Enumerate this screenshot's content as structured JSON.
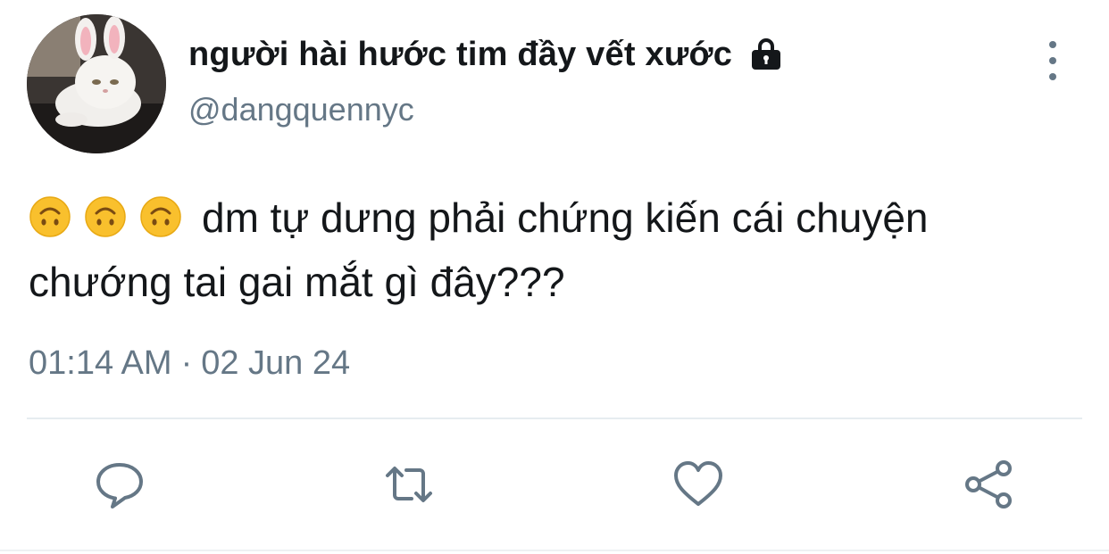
{
  "user": {
    "display_name": "người hài hước tim đầy vết xước",
    "handle": "@dangquennyc",
    "protected": true
  },
  "tweet": {
    "emojis": [
      "upside-down-face",
      "upside-down-face",
      "upside-down-face"
    ],
    "text": "dm tự dưng phải chứng kiến cái chuyện chướng tai gai mắt gì đây???",
    "time": "01:14 AM",
    "separator": "·",
    "date": "02 Jun 24"
  },
  "actions": {
    "reply_icon": "reply-icon",
    "retweet_icon": "retweet-icon",
    "like_icon": "heart-icon",
    "share_icon": "share-icon"
  },
  "colors": {
    "text": "#14171a",
    "secondary": "#657786",
    "divider": "#e6ecf0",
    "emoji": "#f9c02d"
  }
}
